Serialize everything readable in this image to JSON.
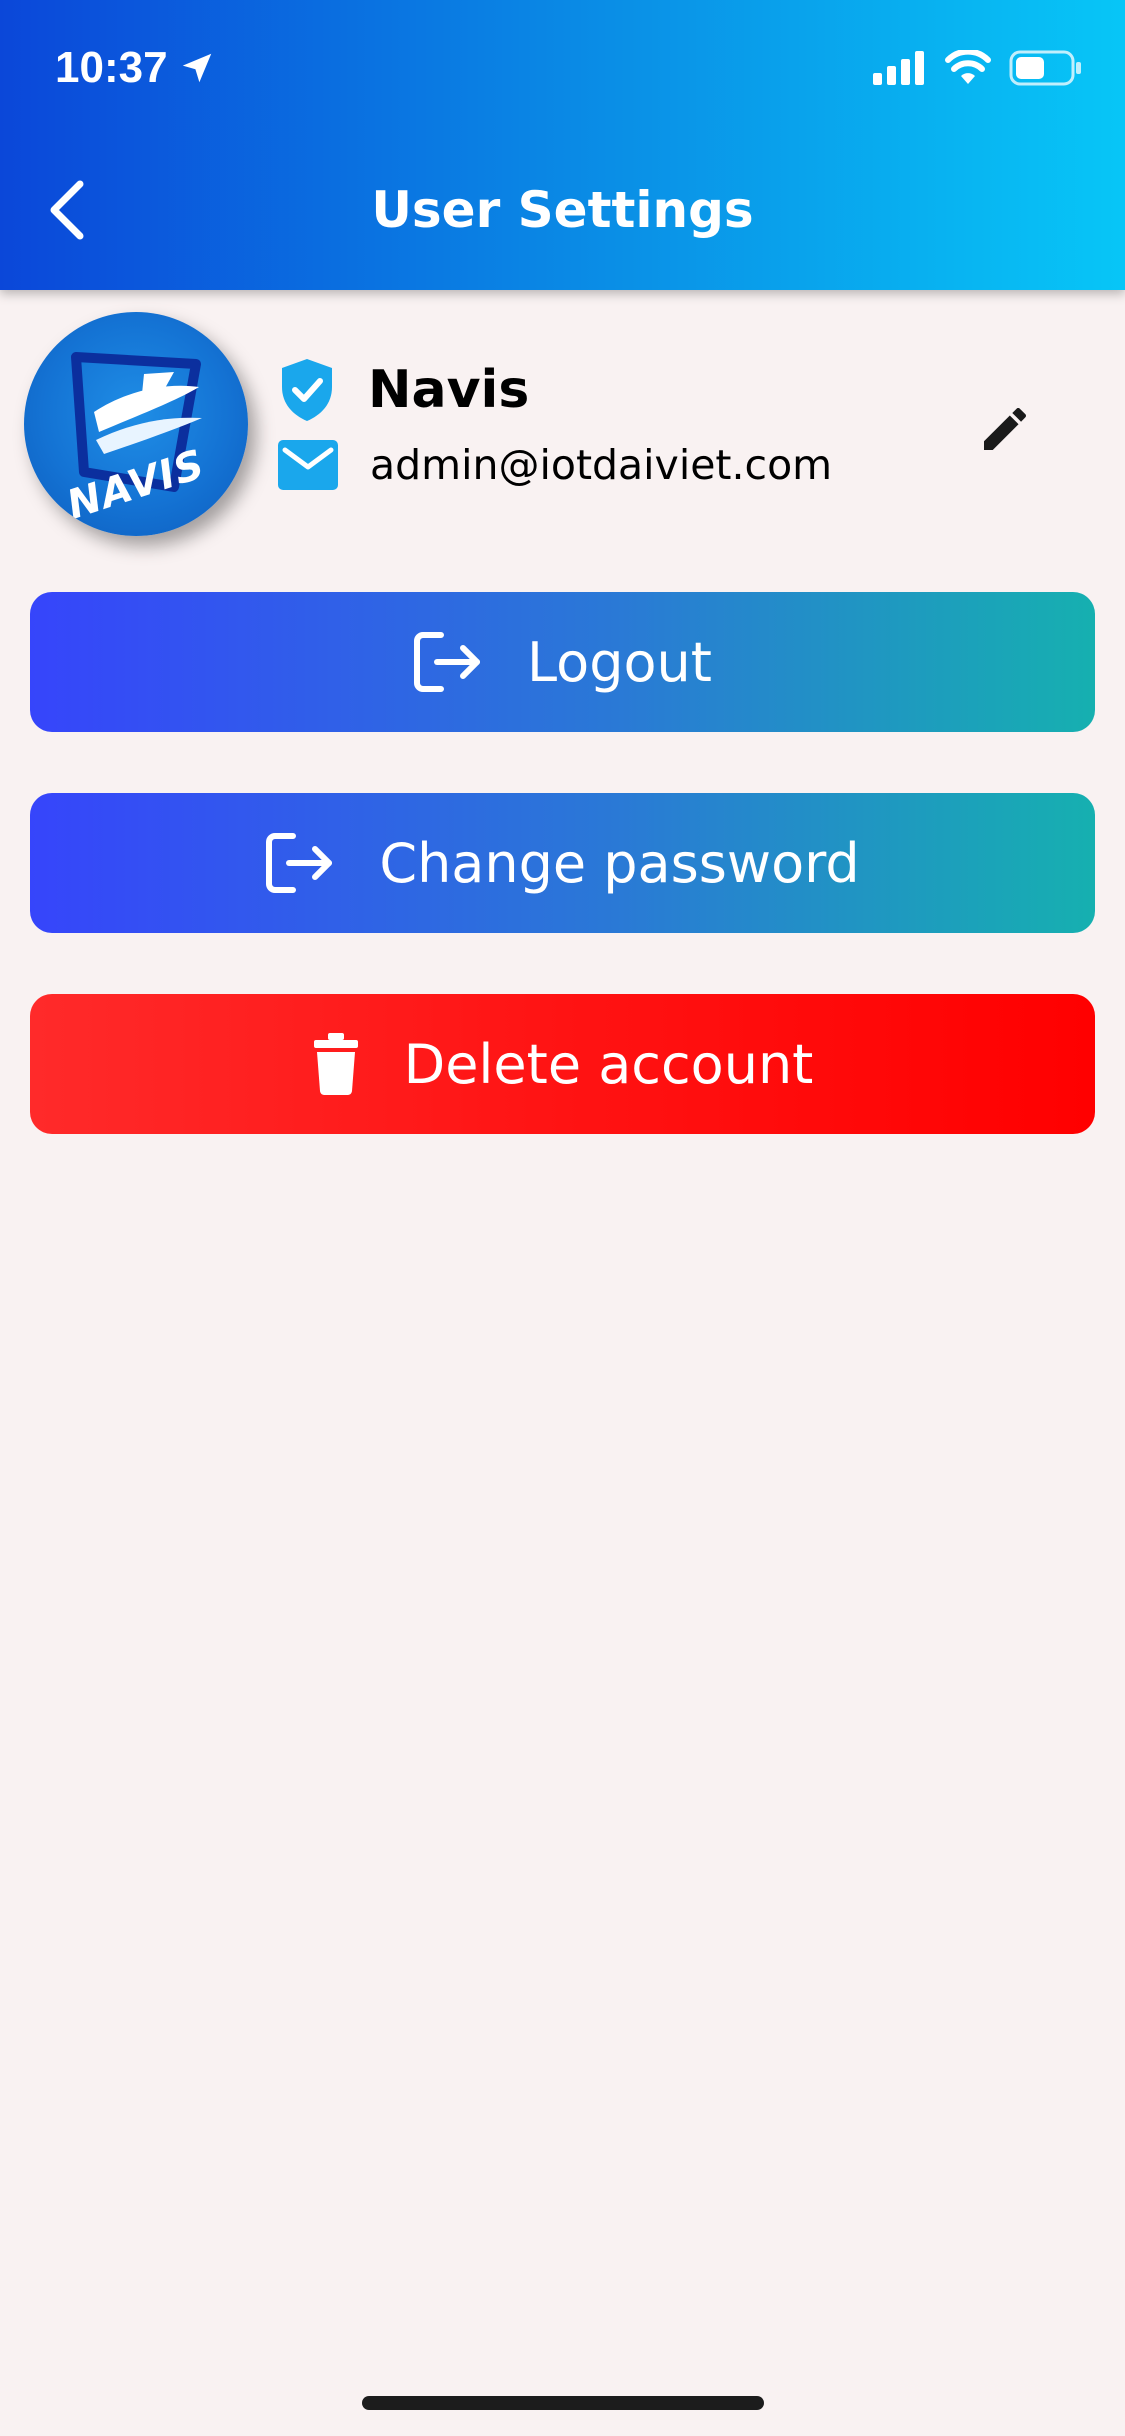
{
  "status_bar": {
    "time": "10:37",
    "icons": [
      "location-arrow-icon",
      "signal-icon",
      "wifi-icon",
      "battery-icon"
    ]
  },
  "header": {
    "title": "User Settings",
    "back_icon": "chevron-left-icon"
  },
  "profile": {
    "avatar_text": "NAVIS",
    "name": "Navis",
    "email": "admin@iotdaiviet.com",
    "verified_icon": "verified-shield-icon",
    "email_icon": "mail-icon",
    "edit_icon": "pencil-icon"
  },
  "actions": {
    "logout_label": "Logout",
    "change_password_label": "Change password",
    "delete_account_label": "Delete account"
  },
  "colors": {
    "header_gradient": [
      "#0b47d9",
      "#07c6f7"
    ],
    "blue_button_gradient": [
      "#3645fb",
      "#16b0b0"
    ],
    "danger": "#ff1a1a",
    "background": "#f9f2f2",
    "icon_accent": "#1aa7ec"
  }
}
